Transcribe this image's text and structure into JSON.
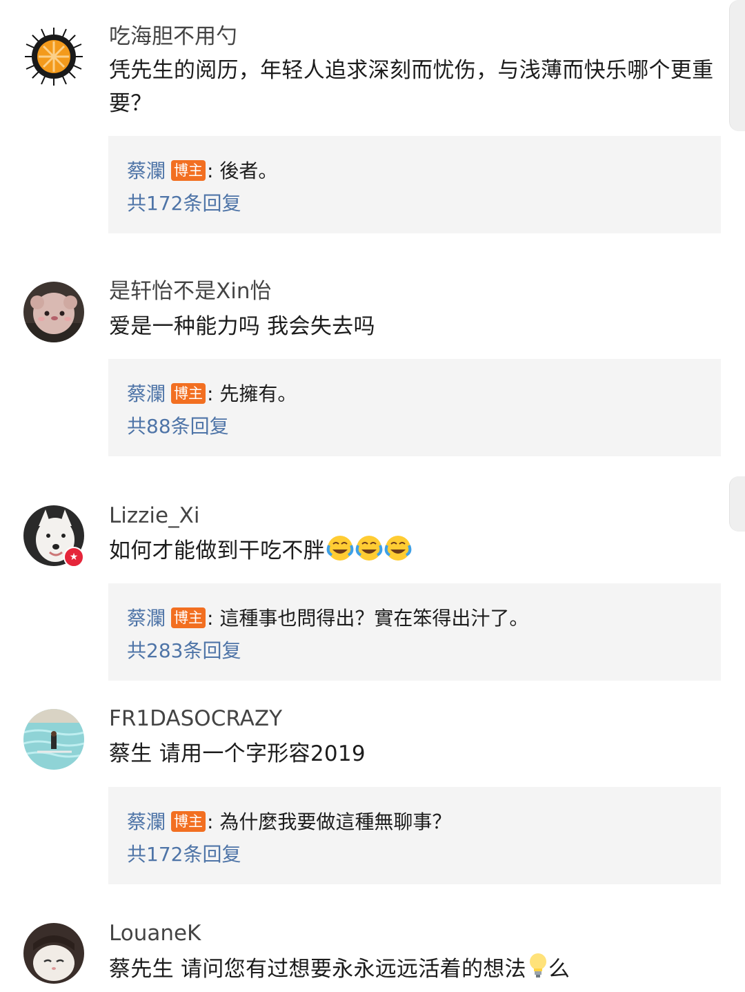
{
  "comments": [
    {
      "username": "吃海胆不用勺",
      "text": "凭先生的阅历，年轻人追求深刻而忧伤，与浅薄而快乐哪个更重要？",
      "reply": {
        "author": "蔡瀾",
        "badge": "博主",
        "text": ": 後者。",
        "count": "共172条回复"
      }
    },
    {
      "username": "是轩怡不是Xin怡",
      "text": "爱是一种能力吗 我会失去吗",
      "reply": {
        "author": "蔡瀾",
        "badge": "博主",
        "text": ": 先擁有。",
        "count": "共88条回复"
      }
    },
    {
      "username": "Lizzie_Xi",
      "text": "如何才能做到干吃不胖",
      "emoji": "laugh-cry-emoji",
      "reply": {
        "author": "蔡瀾",
        "badge": "博主",
        "text": ": 這種事也問得出？實在笨得出汁了。",
        "count": "共283条回复"
      }
    },
    {
      "username": "FR1DASOCRAZY",
      "text": "蔡生 请用一个字形容2019",
      "reply": {
        "author": "蔡瀾",
        "badge": "博主",
        "text": ": 為什麼我要做這種無聊事？",
        "count": "共172条回复"
      }
    },
    {
      "username": "LouaneK",
      "text_before": "蔡先生 请问您有过想要永永远远活着的想法",
      "emoji": "lightbulb-emoji",
      "text_after": "么"
    }
  ],
  "colors": {
    "accent_blue": "#4e74a7",
    "badge_orange": "#f26f21",
    "reply_bg": "#f4f4f4",
    "vip_red": "#e5253a"
  }
}
